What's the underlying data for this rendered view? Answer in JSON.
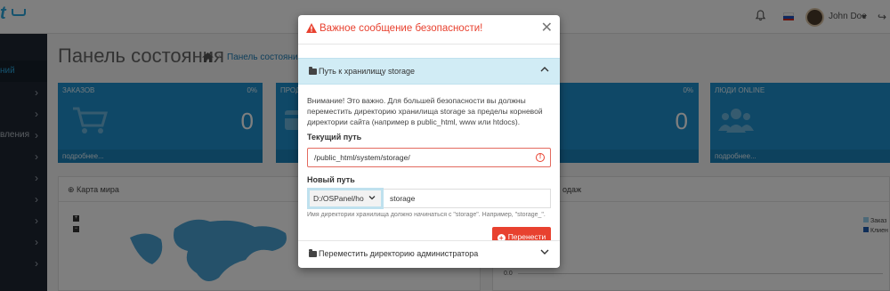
{
  "app": {
    "logo_fragment": "t",
    "user": {
      "name": "John Doe"
    },
    "flag_colors": [
      "#ffffff",
      "#1c4fbf",
      "#d52b1e"
    ]
  },
  "sidebar": {
    "items": [
      {
        "label": "ний",
        "active": true
      },
      {
        "label": ""
      },
      {
        "label": ""
      },
      {
        "label": "вления"
      },
      {
        "label": ""
      },
      {
        "label": ""
      },
      {
        "label": ""
      },
      {
        "label": ""
      },
      {
        "label": ""
      },
      {
        "label": ""
      }
    ]
  },
  "page": {
    "title": "Панель состояния",
    "breadcrumb": "Панель состояния"
  },
  "tiles": [
    {
      "label": "ЗАКАЗОВ",
      "percent": "0%",
      "value": "0",
      "more": "подробнее...",
      "icon": "cart-icon"
    },
    {
      "label": "ПРОД",
      "percent": "",
      "value": "",
      "more": "",
      "icon": "card-icon"
    },
    {
      "label": "",
      "percent": "0%",
      "value": "0",
      "more": "",
      "icon": ""
    },
    {
      "label": "ЛЮДИ ONLINE",
      "percent": "",
      "value": "",
      "more": "подробнее...",
      "icon": "users-icon"
    }
  ],
  "panels": {
    "map_title": "Карта мира",
    "sales_title_fragment": "одаж",
    "legend": [
      "Заказ",
      "Клиен"
    ],
    "axis_tick": "0.0"
  },
  "modal": {
    "title": "Важное сообщение безопасности!",
    "section_open": "Путь к хранилищу storage",
    "warning": "Внимание! Это важно. Для большей безопасности вы должны переместить директорию хранилища storage за пределы корневой директории сайта (например в public_html, www или htdocs).",
    "current_label": "Текущий путь",
    "current_value": "/public_html/system/storage/",
    "new_label": "Новый путь",
    "select_value": "D:/OSPanel/ho",
    "new_value": "storage",
    "hint": "Имя директории хранилища должно начинаться с \"storage\". Например, \"storage_\".",
    "move_button": "Перенести",
    "section_closed": "Переместить директорию администратора"
  },
  "colors": {
    "accent": "#1e91cf",
    "danger": "#e8412f",
    "sidebar_bg": "#1e2733",
    "accordion_bg": "#d1ecf5"
  }
}
